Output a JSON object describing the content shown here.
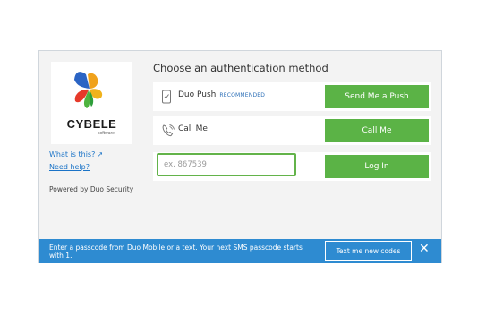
{
  "brand": {
    "name": "CYBELE",
    "sub": "software"
  },
  "links": {
    "what_is_this": "What is this?",
    "need_help": "Need help?"
  },
  "powered_by": "Powered by Duo Security",
  "title": "Choose an authentication method",
  "methods": [
    {
      "icon": "phone-icon",
      "label": "Duo Push",
      "badge": "RECOMMENDED",
      "button": "Send Me a Push"
    },
    {
      "icon": "phone-call-icon",
      "label": "Call Me",
      "button": "Call Me"
    },
    {
      "placeholder": "ex. 867539",
      "button": "Log In"
    }
  ],
  "notice": {
    "text": "Enter a passcode from Duo Mobile or a text. Your next SMS passcode starts with 1.",
    "action": "Text me new codes",
    "close_icon": "close-icon"
  },
  "colors": {
    "accent_green": "#5bb346",
    "notice_blue": "#2e8bd1",
    "link_blue": "#1a73c7"
  }
}
